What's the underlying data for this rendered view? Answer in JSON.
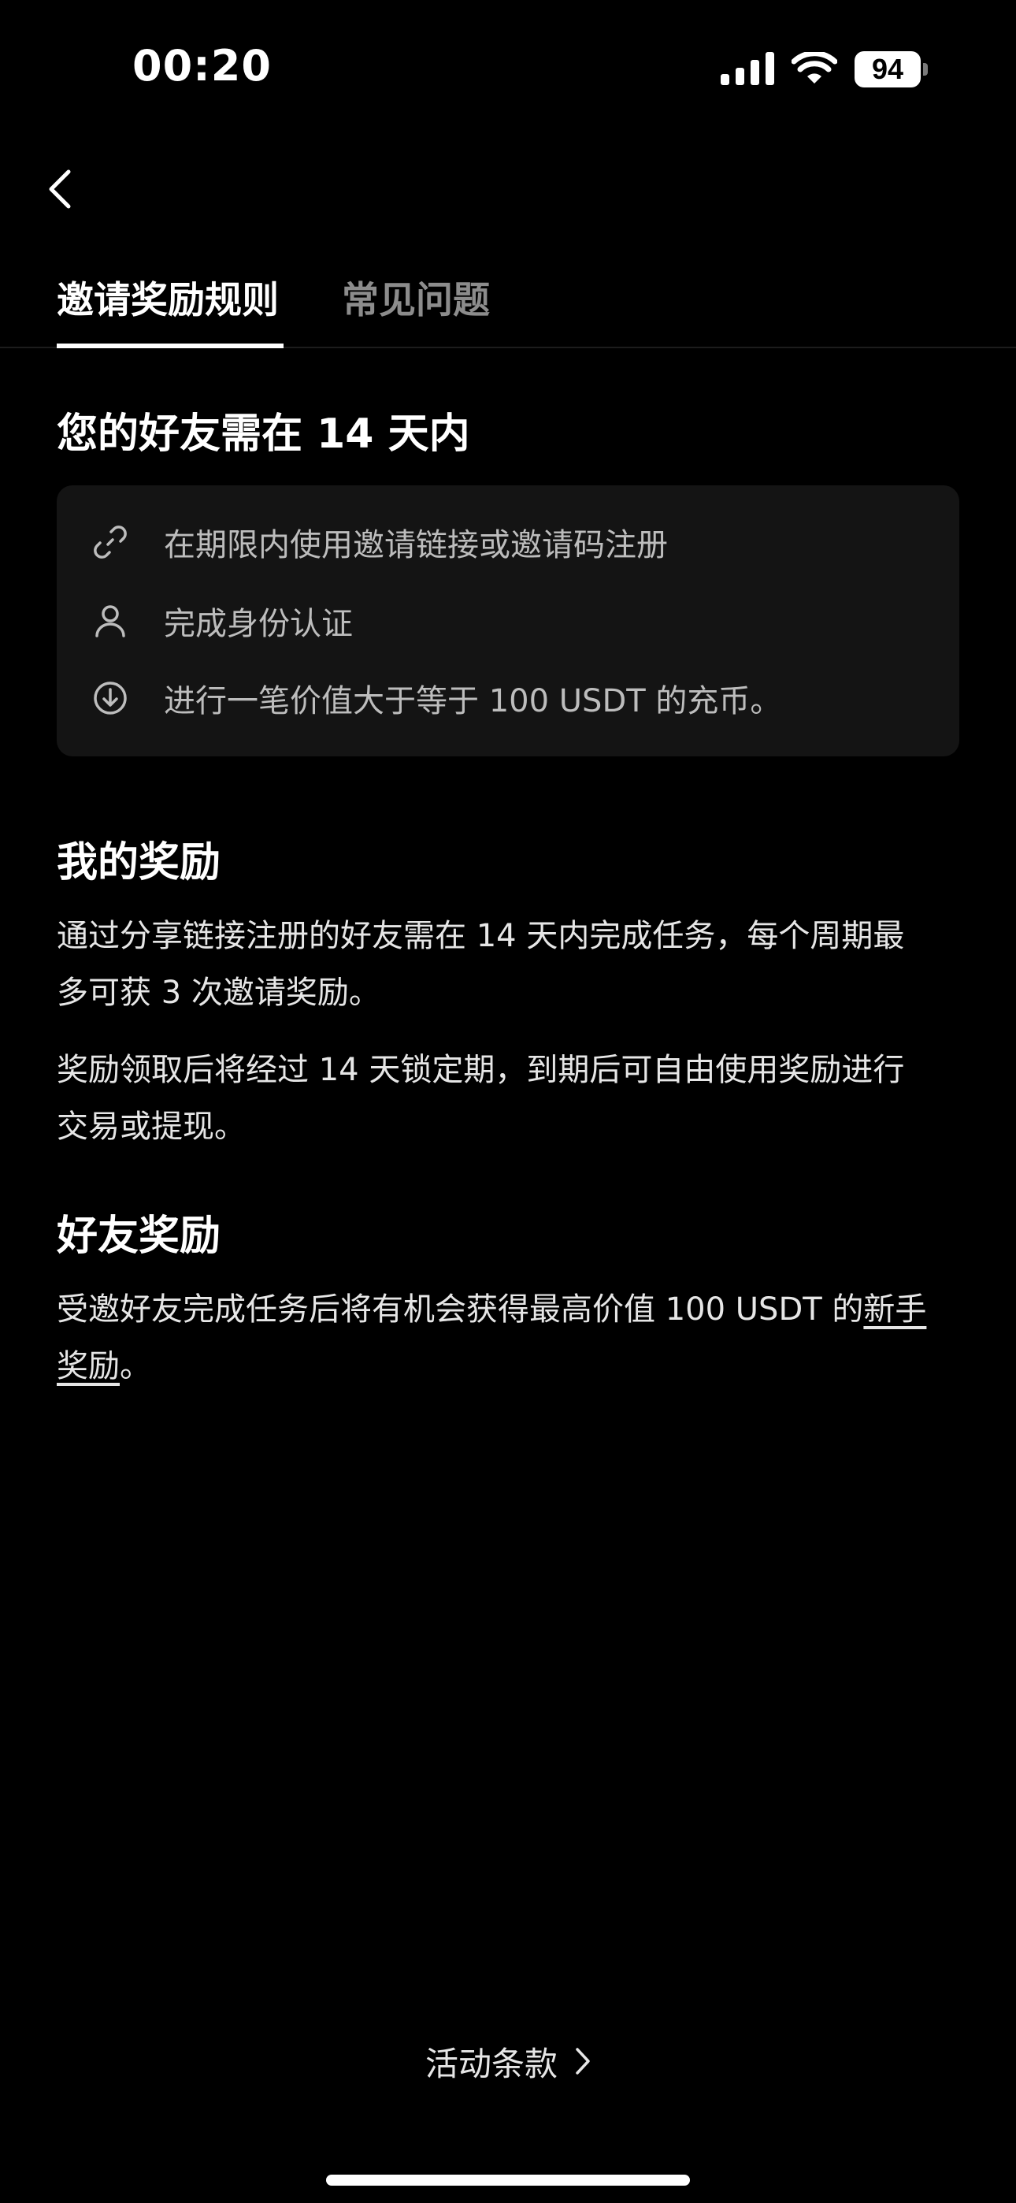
{
  "status_bar": {
    "time": "00:20",
    "battery_level": "94",
    "icons": [
      "signal-icon",
      "wifi-icon",
      "battery-icon"
    ]
  },
  "nav": {
    "back_icon": "chevron-left-icon"
  },
  "tabs": [
    {
      "label": "邀请奖励规则",
      "active": true
    },
    {
      "label": "常见问题",
      "active": false
    }
  ],
  "friend_requirements": {
    "heading": "您的好友需在 14 天内",
    "items": [
      {
        "icon": "link-icon",
        "text": "在期限内使用邀请链接或邀请码注册"
      },
      {
        "icon": "user-icon",
        "text": "完成身份认证"
      },
      {
        "icon": "deposit-icon",
        "text": "进行一笔价值大于等于 100 USDT 的充币。"
      }
    ]
  },
  "my_reward": {
    "heading": "我的奖励",
    "paragraph_1_line_1": "通过分享链接注册的好友需在 14 天内完成任务，每个周期最",
    "paragraph_1_line_2": "多可获 3 次邀请奖励。",
    "paragraph_2_line_1": "奖励领取后将经过 14 天锁定期，到期后可自由使用奖励进行",
    "paragraph_2_line_2": "交易或提现。"
  },
  "friend_reward": {
    "heading": "好友奖励",
    "text_before_link": "受邀好友完成任务后将有机会获得最高价值 100 USDT 的",
    "link_part_1": "新手",
    "link_part_2": "奖励",
    "text_after_link": "。"
  },
  "footer": {
    "terms_label": "活动条款",
    "terms_icon": "chevron-right-icon"
  },
  "colors": {
    "background": "#000000",
    "card": "#141414",
    "text_primary": "#ffffff",
    "text_secondary": "#bdbdbd",
    "tab_inactive": "#8c8c8c"
  }
}
